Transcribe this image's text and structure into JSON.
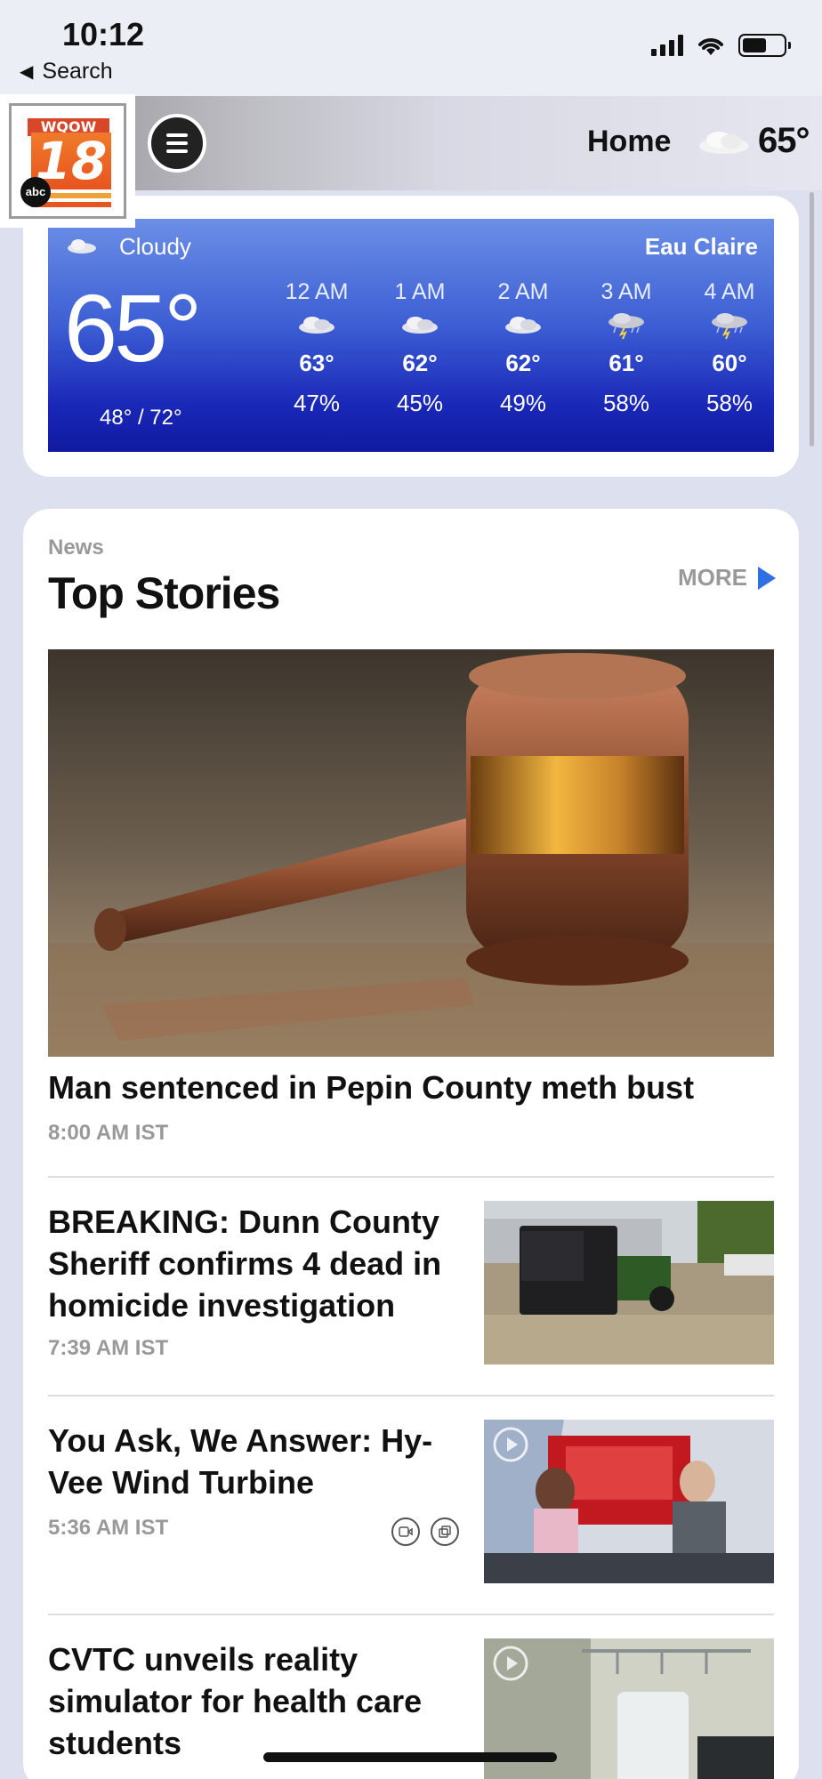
{
  "status_bar": {
    "time": "10:12",
    "back_label": "Search"
  },
  "header": {
    "logo_top": "WQOW",
    "logo_number": "18",
    "logo_network": "abc",
    "home_label": "Home",
    "temp": "65°"
  },
  "weather": {
    "condition": "Cloudy",
    "city": "Eau Claire",
    "current_temp": "65°",
    "hi_lo": "48° / 72°",
    "hourly": [
      {
        "time": "12 AM",
        "icon": "cloud-icon",
        "temp": "63°",
        "precip": "47%"
      },
      {
        "time": "1 AM",
        "icon": "cloud-icon",
        "temp": "62°",
        "precip": "45%"
      },
      {
        "time": "2 AM",
        "icon": "cloud-icon",
        "temp": "62°",
        "precip": "49%"
      },
      {
        "time": "3 AM",
        "icon": "thunderstorm-icon",
        "temp": "61°",
        "precip": "58%"
      },
      {
        "time": "4 AM",
        "icon": "thunderstorm-icon",
        "temp": "60°",
        "precip": "58%"
      }
    ],
    "colors": {
      "top": "#6b8fe6",
      "bottom": "#0f1aa0"
    }
  },
  "news": {
    "kicker": "News",
    "title": "Top Stories",
    "more_label": "MORE",
    "hero": {
      "title": "Man sentenced in Pepin County meth bust",
      "time": "8:00 AM IST"
    },
    "stories": [
      {
        "title": "BREAKING: Dunn County Sheriff confirms 4 dead in homicide investigation",
        "time": "7:39 AM IST"
      },
      {
        "title": "You Ask, We Answer: Hy-Vee Wind Turbine",
        "time": "5:36 AM IST"
      },
      {
        "title": "CVTC unveils reality simulator for health care students",
        "time": ""
      }
    ]
  }
}
